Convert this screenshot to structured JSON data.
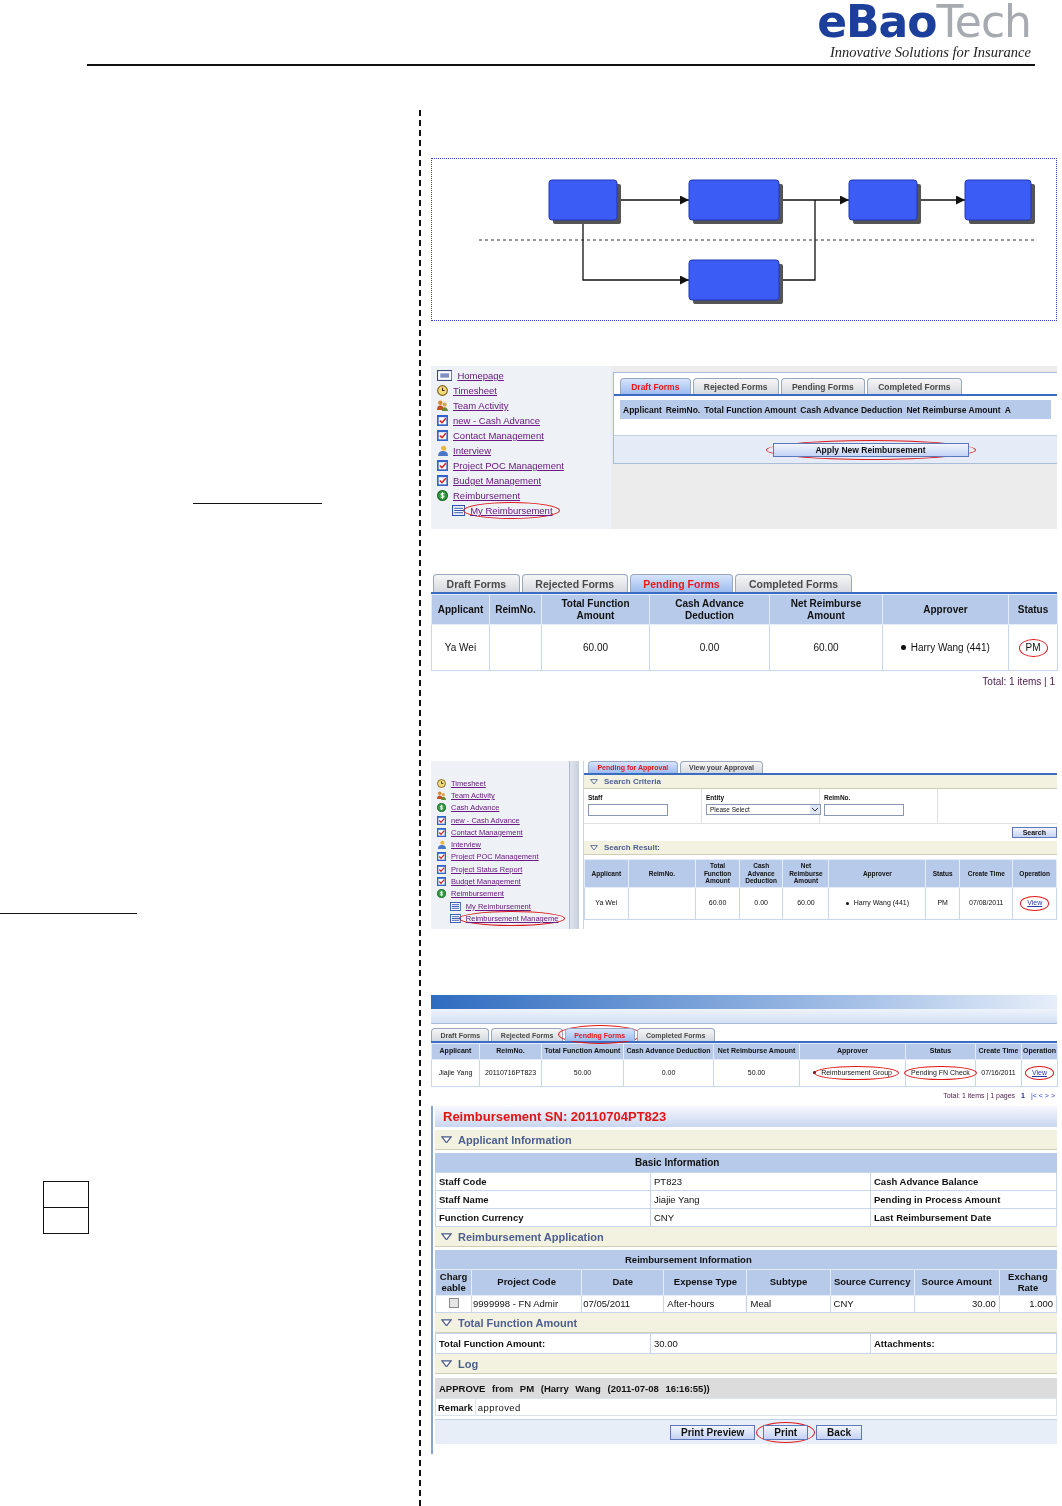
{
  "header": {
    "logo_bold": "eBao",
    "logo_light": "Tech",
    "tagline": "Innovative Solutions for Insurance"
  },
  "my_reimbursement_page": {
    "menu": [
      {
        "label": "Homepage",
        "kind": "home",
        "circled": false
      },
      {
        "label": "Timesheet",
        "kind": "clock",
        "circled": false
      },
      {
        "label": "Team Activity",
        "kind": "team",
        "circled": false
      },
      {
        "label": "new - Cash Advance",
        "kind": "form",
        "circled": false
      },
      {
        "label": "Contact Management",
        "kind": "form",
        "circled": false
      },
      {
        "label": "Interview",
        "kind": "person",
        "circled": false
      },
      {
        "label": "Project POC Management",
        "kind": "form",
        "circled": false
      },
      {
        "label": "Budget Management",
        "kind": "form",
        "circled": false
      },
      {
        "label": "Reimbursement",
        "kind": "coin",
        "circled": false,
        "children": [
          {
            "label": "My Reimbursement",
            "kind": "list",
            "circled": true
          }
        ]
      }
    ],
    "tabs": [
      {
        "label": "Draft Forms",
        "selected": true,
        "circled": false
      },
      {
        "label": "Rejected Forms",
        "selected": false,
        "circled": false
      },
      {
        "label": "Pending Forms",
        "selected": false,
        "circled": false
      },
      {
        "label": "Completed Forms",
        "selected": false,
        "circled": false
      }
    ],
    "columns": [
      "Applicant",
      "ReimNo.",
      "Total Function Amount",
      "Cash Advance Deduction",
      "Net Reimburse Amount",
      "A"
    ],
    "apply_button": {
      "label": "Apply New Reimbursement",
      "circled": true
    }
  },
  "pending_forms_list": {
    "tabs": [
      {
        "label": "Draft Forms",
        "selected": false,
        "circled": false
      },
      {
        "label": "Rejected Forms",
        "selected": false,
        "circled": false
      },
      {
        "label": "Pending Forms",
        "selected": true,
        "circled": false
      },
      {
        "label": "Completed Forms",
        "selected": false,
        "circled": false
      }
    ],
    "columns": [
      "Applicant",
      "ReimNo.",
      "Total Function Amount",
      "Cash Advance Deduction",
      "Net Reimburse Amount",
      "Approver",
      "Status"
    ],
    "rows": [
      {
        "applicant": "Ya Wei",
        "total": "60.00",
        "deduction": "0.00",
        "net": "60.00",
        "approver": "Harry Wang (441)",
        "approver_circled": false,
        "status": "PM",
        "status_circled": true
      }
    ],
    "footer": "Total: 1 items | 1"
  },
  "approval_page": {
    "menu": [
      {
        "label": "Timesheet",
        "kind": "clock",
        "circled": false
      },
      {
        "label": "Team Activity",
        "kind": "team",
        "circled": false
      },
      {
        "label": "Cash Advance",
        "kind": "coin",
        "circled": false
      },
      {
        "label": "new - Cash Advance",
        "kind": "form",
        "circled": false
      },
      {
        "label": "Contact Management",
        "kind": "form",
        "circled": false
      },
      {
        "label": "Interview",
        "kind": "person",
        "circled": false
      },
      {
        "label": "Project POC Management",
        "kind": "form",
        "circled": false
      },
      {
        "label": "Project Status Report",
        "kind": "form",
        "circled": false
      },
      {
        "label": "Budget Management",
        "kind": "form",
        "circled": false
      },
      {
        "label": "Reimbursement",
        "kind": "coin",
        "circled": false,
        "children": [
          {
            "label": "My Reimbursement",
            "kind": "list",
            "circled": false
          },
          {
            "label": "Reimbursement Manageme",
            "kind": "list",
            "circled": true
          }
        ]
      }
    ],
    "tabs": [
      {
        "label": "Pending for Approval",
        "selected": true,
        "circled": false
      },
      {
        "label": "View your Approval",
        "selected": false,
        "circled": false
      }
    ],
    "criteria_title": "Search Criteria",
    "fields": [
      {
        "label": "Staff",
        "kind": "text"
      },
      {
        "label": "Entity",
        "kind": "select",
        "selected_option": "Please Select"
      },
      {
        "label": "ReimNo.",
        "kind": "text"
      }
    ],
    "search_button": "Search",
    "result_title": "Search Result:",
    "columns": [
      "Applicant",
      "ReimNo.",
      "Total Function Amount",
      "Cash Advance Deduction",
      "Net Reimburse Amount",
      "Approver",
      "Status",
      "Create Time",
      "Operation"
    ],
    "rows": [
      {
        "applicant": "Ya Wei",
        "total": "60.00",
        "deduction": "0.00",
        "net": "60.00",
        "approver": "Harry Wang (441)",
        "approver_circled": false,
        "status": "PM",
        "status_circled": false,
        "create_time": "07/08/2011",
        "operation": "View",
        "operation_circled": true
      }
    ]
  },
  "reimbursement_list": {
    "tabs": [
      {
        "label": "Draft Forms",
        "selected": false,
        "circled": false
      },
      {
        "label": "Rejected Forms",
        "selected": false,
        "circled": false
      },
      {
        "label": "Pending Forms",
        "selected": true,
        "circled": true
      },
      {
        "label": "Completed Forms",
        "selected": false,
        "circled": false
      }
    ],
    "columns": [
      "Applicant",
      "ReimNo.",
      "Total Function Amount",
      "Cash Advance Deduction",
      "Net Reimburse Amount",
      "Approver",
      "Status",
      "Create Time",
      "Operation"
    ],
    "rows": [
      {
        "applicant": "Jiajie Yang",
        "reim_no": "20110716PT823",
        "total": "50.00",
        "deduction": "0.00",
        "net": "50.00",
        "approver": "Reimbursement Group",
        "approver_circled": true,
        "status": "Pending FN Check",
        "status_circled": true,
        "create_time": "07/16/2011",
        "operation": "View",
        "operation_circled": true
      }
    ],
    "footer": "Total: 1 items | 1 pages",
    "current_page": "1",
    "pager": "|< < > >"
  },
  "reimbursement_detail": {
    "title": "Reimbursement SN: 20110704PT823",
    "applicant_section": "Applicant Information",
    "basic_header": "Basic Information",
    "basic_rows": [
      {
        "label": "Staff Code",
        "value": "PT823",
        "side_label": "Cash Advance Balance"
      },
      {
        "label": "Staff Name",
        "value": "Jiajie Yang",
        "side_label": "Pending in Process Amount"
      },
      {
        "label": "Function Currency",
        "value": "CNY",
        "side_label": "Last Reimbursement Date"
      }
    ],
    "application_section": "Reimbursement Application",
    "info_header": "Reimbursement Information",
    "columns": [
      "Charg eable",
      "Project Code",
      "Date",
      "Expense Type",
      "Subtype",
      "Source Currency",
      "Source Amount",
      "Exchang Rate"
    ],
    "rows": [
      {
        "chargeable": false,
        "project_code": "9999998 - FN Admir",
        "date": "07/05/2011",
        "expense_type": "After-hours",
        "subtype": "Meal",
        "currency": "CNY",
        "amount": "30.00",
        "rate": "1.000"
      }
    ],
    "total_section": "Total Function Amount",
    "total_label": "Total Function Amount:",
    "total_value": "30.00",
    "attachments_label": "Attachments:",
    "log_section": "Log",
    "log_entry": "APPROVE from PM (Harry Wang (2011-07-08 16:16:55))",
    "remark_label": "Remark",
    "remark": "approved",
    "buttons": [
      {
        "label": "Print Preview",
        "circled": false
      },
      {
        "label": "Print",
        "circled": true
      },
      {
        "label": "Back",
        "circled": false
      }
    ]
  }
}
